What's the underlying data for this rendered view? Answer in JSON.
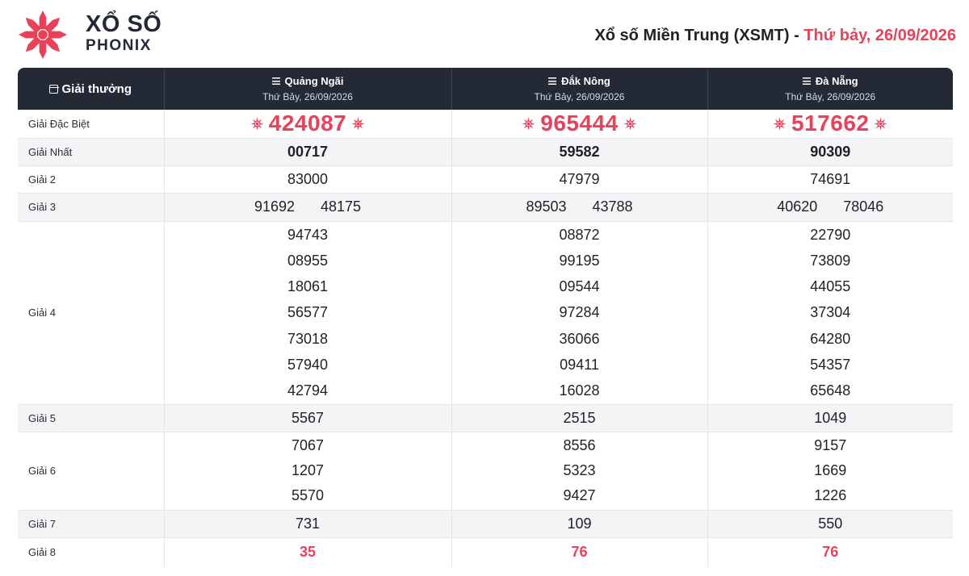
{
  "brand": {
    "line1": "XỔ SỐ",
    "line2": "PHONIX",
    "logo_color": "#e8425a"
  },
  "title": {
    "main": "Xổ số Miền Trung (XSMT) - ",
    "date": "Thứ bảy, 26/09/2026"
  },
  "table": {
    "prize_header": "Giải thưởng",
    "provinces": [
      {
        "name": "Quảng Ngãi",
        "date": "Thứ Bảy, 26/09/2026"
      },
      {
        "name": "Đắk Nông",
        "date": "Thứ Bảy, 26/09/2026"
      },
      {
        "name": "Đà Nẵng",
        "date": "Thứ Bảy, 26/09/2026"
      }
    ],
    "prizes": {
      "db": {
        "label": "Giải Đặc Biệt",
        "values": [
          [
            "424087"
          ],
          [
            "965444"
          ],
          [
            "517662"
          ]
        ]
      },
      "nhat": {
        "label": "Giải Nhất",
        "values": [
          [
            "00717"
          ],
          [
            "59582"
          ],
          [
            "90309"
          ]
        ]
      },
      "g2": {
        "label": "Giải 2",
        "values": [
          [
            "83000"
          ],
          [
            "47979"
          ],
          [
            "74691"
          ]
        ]
      },
      "g3": {
        "label": "Giải 3",
        "values": [
          [
            "91692",
            "48175"
          ],
          [
            "89503",
            "43788"
          ],
          [
            "40620",
            "78046"
          ]
        ]
      },
      "g4": {
        "label": "Giải 4",
        "values": [
          [
            "94743",
            "08955",
            "18061",
            "56577",
            "73018",
            "57940",
            "42794"
          ],
          [
            "08872",
            "99195",
            "09544",
            "97284",
            "36066",
            "09411",
            "16028"
          ],
          [
            "22790",
            "73809",
            "44055",
            "37304",
            "64280",
            "54357",
            "65648"
          ]
        ]
      },
      "g5": {
        "label": "Giải 5",
        "values": [
          [
            "5567"
          ],
          [
            "2515"
          ],
          [
            "1049"
          ]
        ]
      },
      "g6": {
        "label": "Giải 6",
        "values": [
          [
            "7067",
            "1207",
            "5570"
          ],
          [
            "8556",
            "5323",
            "9427"
          ],
          [
            "9157",
            "1669",
            "1226"
          ]
        ]
      },
      "g7": {
        "label": "Giải 7",
        "values": [
          [
            "731"
          ],
          [
            "109"
          ],
          [
            "550"
          ]
        ]
      },
      "g8": {
        "label": "Giải 8",
        "values": [
          [
            "35"
          ],
          [
            "76"
          ],
          [
            "76"
          ]
        ]
      }
    }
  },
  "icons": {
    "logo": "phonix-star-logo-icon",
    "prize_header": "calendar-icon",
    "province_header": "list-icon",
    "special_marker": "star-burst-icon"
  },
  "colors": {
    "accent": "#e8425a",
    "header_bg": "#232a36",
    "alt_row": "#f3f4f6"
  }
}
